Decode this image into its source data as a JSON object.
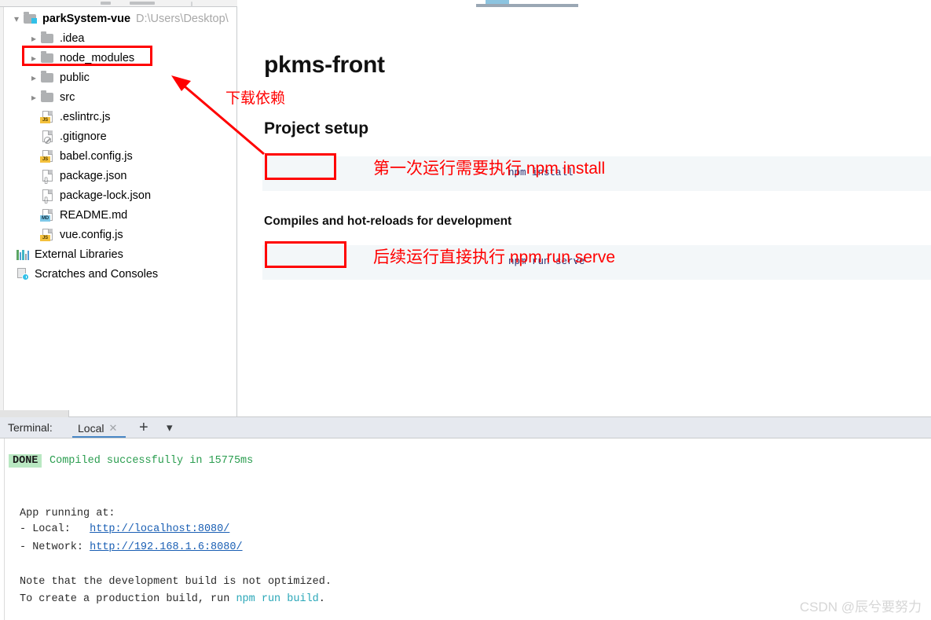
{
  "sidebar": {
    "root": {
      "name": "parkSystem-vue",
      "path": "D:\\Users\\Desktop\\",
      "arrow": "chevron-down-icon"
    },
    "items": [
      {
        "label": ".idea",
        "icon": "folder-icon",
        "arrow": "chevron-right-icon",
        "badge": ""
      },
      {
        "label": "node_modules",
        "icon": "folder-icon",
        "arrow": "chevron-right-icon",
        "badge": ""
      },
      {
        "label": "public",
        "icon": "folder-icon",
        "arrow": "chevron-right-icon",
        "badge": ""
      },
      {
        "label": "src",
        "icon": "folder-icon",
        "arrow": "chevron-right-icon",
        "badge": ""
      },
      {
        "label": ".eslintrc.js",
        "icon": "js-file-icon",
        "arrow": "",
        "badge": "JS"
      },
      {
        "label": ".gitignore",
        "icon": "gitignore-file-icon",
        "arrow": "",
        "badge": ""
      },
      {
        "label": "babel.config.js",
        "icon": "js-file-icon",
        "arrow": "",
        "badge": "JS"
      },
      {
        "label": "package.json",
        "icon": "json-file-icon",
        "arrow": "",
        "badge": "{}"
      },
      {
        "label": "package-lock.json",
        "icon": "json-file-icon",
        "arrow": "",
        "badge": "{}"
      },
      {
        "label": "README.md",
        "icon": "md-file-icon",
        "arrow": "",
        "badge": "MD"
      },
      {
        "label": "vue.config.js",
        "icon": "js-file-icon",
        "arrow": "",
        "badge": "JS"
      }
    ],
    "external_libraries": {
      "label": "External Libraries",
      "icon": "libraries-bars-icon"
    },
    "scratches": {
      "label": "Scratches and Consoles",
      "icon": "scratches-clock-icon"
    }
  },
  "preview": {
    "title": "pkms-front",
    "section_setup": "Project setup",
    "section_compile": "Compiles and hot-reloads for development",
    "code_install": "npm install",
    "code_serve": "npm run serve"
  },
  "annotations": {
    "download_dependencies": "下载依赖",
    "first_run": "第一次运行需要执行 npm  install",
    "subsequent_run": "后续运行直接执行 npm run serve",
    "arrow": "red-arrow-icon",
    "highlight_color": "#ff0000"
  },
  "terminal": {
    "panel_label": "Terminal:",
    "tab_name": "Local",
    "tab_close_icon": "close-icon",
    "add_icon": "plus-icon",
    "menu_icon": "chevron-down-icon",
    "status_badge": "DONE",
    "status_message": "Compiled successfully in 15775ms",
    "app_running": "App running at:",
    "local_label": "- Local:   ",
    "local_url": "http://localhost:8080/",
    "network_label": "- Network: ",
    "network_url": "http://192.168.1.6:8080/",
    "note_line": "Note that the development build is not optimized.",
    "create_prefix": "To create a production build, run ",
    "create_cmd": "npm run build",
    "create_suffix": "."
  },
  "watermark": {
    "text": "CSDN @辰兮要努力"
  }
}
